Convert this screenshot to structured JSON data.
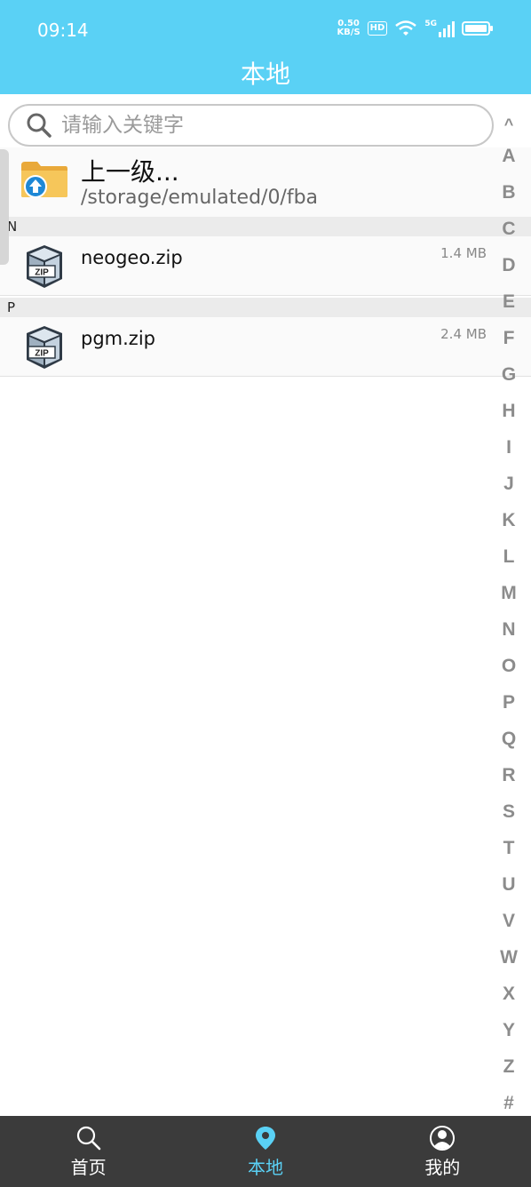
{
  "status_bar": {
    "time": "09:14",
    "net_speed_value": "0.50",
    "net_speed_unit": "KB/S",
    "hd": "HD",
    "signal_label": "5G"
  },
  "header": {
    "title": "本地"
  },
  "search": {
    "placeholder": "请输入关键字",
    "icon": "search-icon"
  },
  "parent_entry": {
    "title": "上一级...",
    "path": "/storage/emulated/0/fba",
    "icon": "folder-up-icon"
  },
  "sections": [
    {
      "letter": "N",
      "files": [
        {
          "name": "neogeo.zip",
          "size": "1.4 MB",
          "icon": "zip-icon"
        }
      ]
    },
    {
      "letter": "P",
      "files": [
        {
          "name": "pgm.zip",
          "size": "2.4 MB",
          "icon": "zip-icon"
        }
      ]
    }
  ],
  "alphabet_index": [
    "^",
    "A",
    "B",
    "C",
    "D",
    "E",
    "F",
    "G",
    "H",
    "I",
    "J",
    "K",
    "L",
    "M",
    "N",
    "O",
    "P",
    "Q",
    "R",
    "S",
    "T",
    "U",
    "V",
    "W",
    "X",
    "Y",
    "Z",
    "#"
  ],
  "bottom_nav": [
    {
      "label": "首页",
      "icon": "search-icon",
      "active": false
    },
    {
      "label": "本地",
      "icon": "location-pin-icon",
      "active": true
    },
    {
      "label": "我的",
      "icon": "user-icon",
      "active": false
    }
  ],
  "colors": {
    "accent": "#5ad1f5",
    "nav_bg": "#3b3b3b",
    "section_bg": "#ebebeb"
  }
}
